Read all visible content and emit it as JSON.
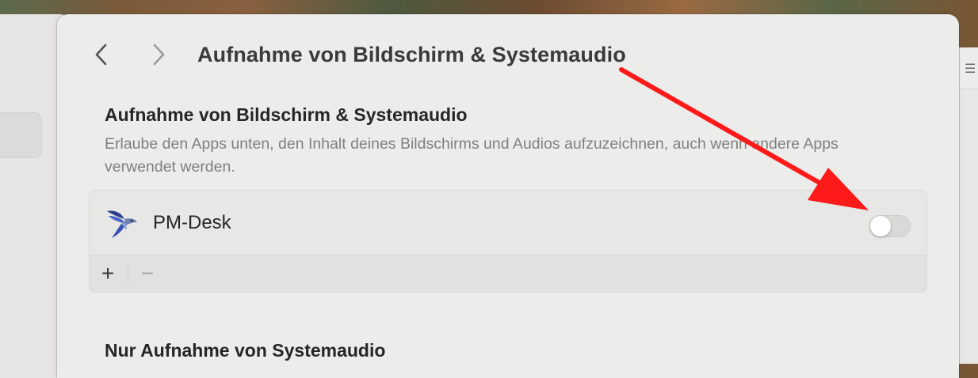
{
  "window": {
    "title": "Aufnahme von Bildschirm & Systemaudio"
  },
  "nav": {
    "back_icon": "chevron-left-icon",
    "forward_icon": "chevron-right-icon"
  },
  "section1": {
    "title": "Aufnahme von Bildschirm & Systemaudio",
    "description": "Erlaube den Apps unten, den Inhalt deines Bildschirms und Audios aufzuzeichnen, auch wenn andere Apps verwendet werden."
  },
  "apps": [
    {
      "name": "PM-Desk",
      "icon": "bird-icon",
      "enabled": false
    }
  ],
  "list_controls": {
    "add_label": "+",
    "remove_label": "−"
  },
  "section2": {
    "title": "Nur Aufnahme von Systemaudio"
  },
  "annotation": {
    "arrow_color": "#ff1a1a"
  },
  "sidebar_right": {
    "icon": "list-icon",
    "glyph": "☰"
  }
}
